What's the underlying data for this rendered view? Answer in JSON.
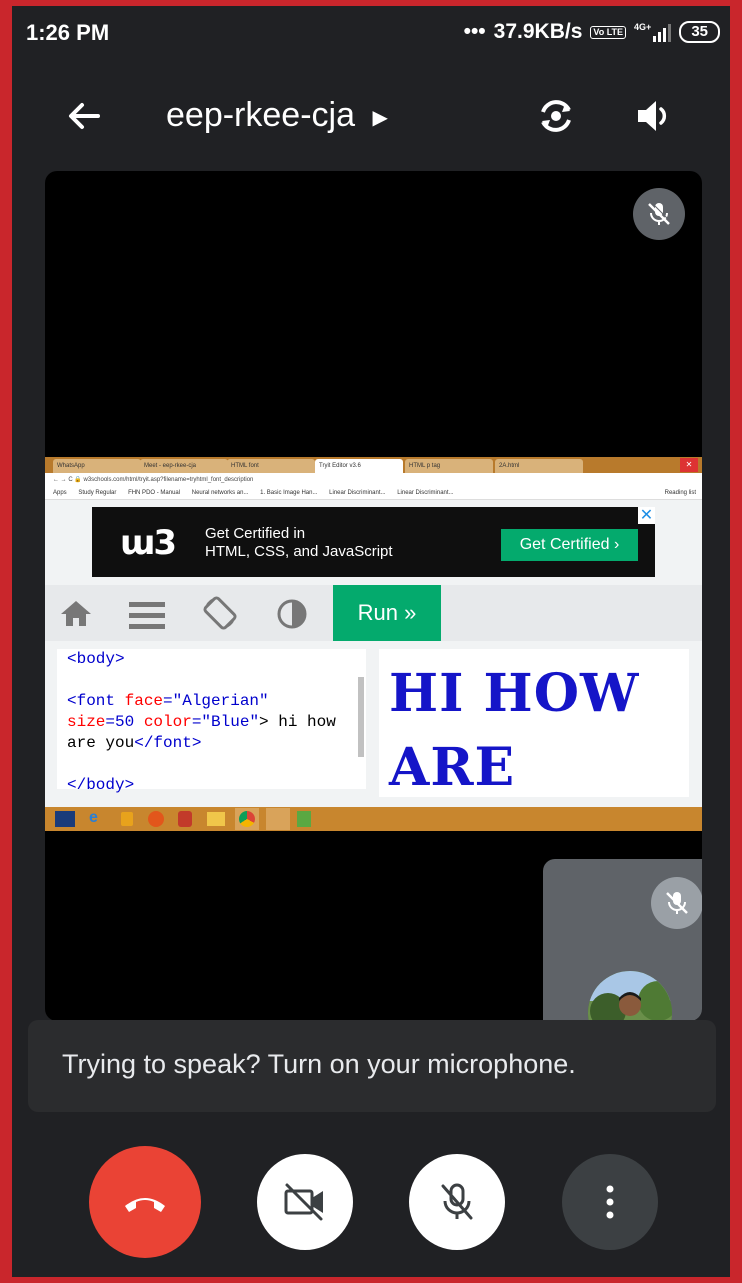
{
  "status_bar": {
    "time": "1:26 PM",
    "network_speed": "37.9KB/s",
    "volte_label": "Vo LTE",
    "network_type": "4G+",
    "battery": "35"
  },
  "header": {
    "meeting_code": "eep-rkee-cja"
  },
  "shared_screen": {
    "tabs": [
      "WhatsApp",
      "Meet - eep-rkee-cja",
      "HTML font",
      "Tryit Editor v3.6",
      "HTML p tag",
      "2A.html"
    ],
    "url": "w3schools.com/html/tryit.asp?filename=tryhtml_font_description",
    "bookmarks": [
      "Apps",
      "Study Regular",
      "FHN PDO - Manual",
      "Neural networks an...",
      "1. Basic Image Han...",
      "Linear Discriminant...",
      "Linear Discriminant...",
      "Reading list"
    ],
    "ad": {
      "line1": "Get Certified in",
      "line2": "HTML, CSS, and JavaScript",
      "cta": "Get Certified ›",
      "close": "✕"
    },
    "run_label": "Run »",
    "code": {
      "line1": "<body>",
      "line3_a": "<font ",
      "line3_b": "face",
      "line3_c": "=\"Algerian\"",
      "line4_a": "size",
      "line4_b": "=50 ",
      "line4_c": "color",
      "line4_d": "=\"Blue\"",
      "line4_e": "> hi how",
      "line5_a": "are you",
      "line5_b": "</font>",
      "line7": "</body>"
    },
    "result": {
      "line1": "HI HOW",
      "line2": "ARE"
    }
  },
  "toast": {
    "message": "Trying to speak? Turn on your microphone."
  },
  "colors": {
    "end_call": "#ea4335",
    "control_light": "#ffffff",
    "control_dark": "#3c4043",
    "w3_green": "#04aa6d"
  }
}
